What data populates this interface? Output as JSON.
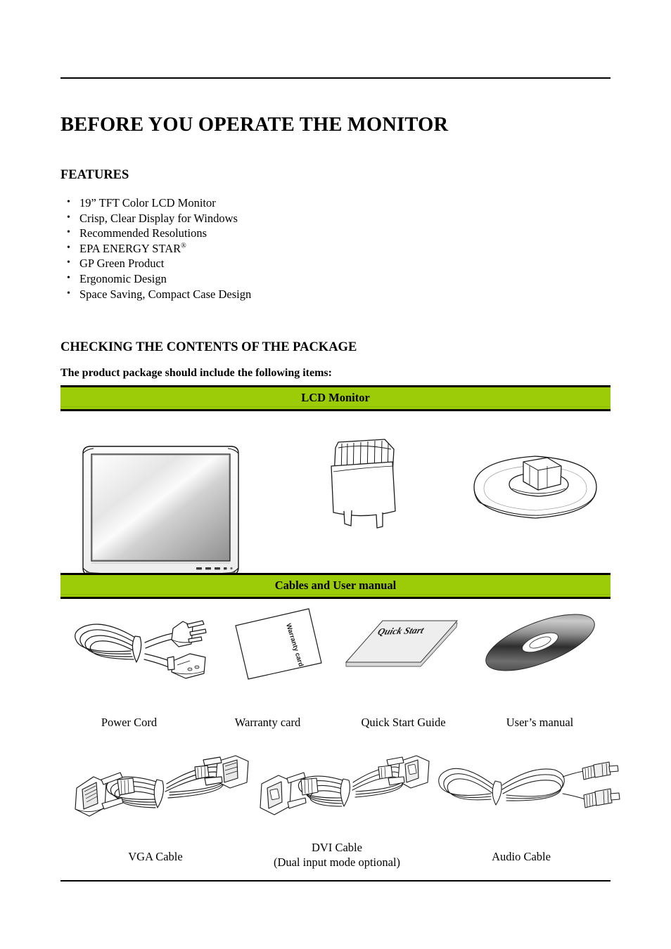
{
  "document": {
    "title": "BEFORE YOU OPERATE THE MONITOR",
    "sections": {
      "features_heading": "FEATURES",
      "checking_heading": "CHECKING THE CONTENTS OF THE PACKAGE",
      "package_lead": "The product package should include the following items:"
    },
    "features": [
      {
        "text": "19” TFT Color LCD Monitor",
        "sup": ""
      },
      {
        "text": "Crisp, Clear Display for Windows",
        "sup": ""
      },
      {
        "text": "Recommended Resolutions",
        "sup": ""
      },
      {
        "text": "EPA ENERGY STAR",
        "sup": "®"
      },
      {
        "text": "GP Green Product",
        "sup": ""
      },
      {
        "text": "Ergonomic Design",
        "sup": ""
      },
      {
        "text": "Space Saving, Compact Case Design",
        "sup": ""
      }
    ],
    "package": {
      "band_monitor": "LCD Monitor",
      "band_cables": "Cables and User manual",
      "accent_color": "#9ccc07",
      "monitor_items": [
        {
          "name": "lcd-panel",
          "label": ""
        },
        {
          "name": "stand-neck",
          "label": ""
        },
        {
          "name": "stand-base",
          "label": ""
        }
      ],
      "media_items": [
        {
          "name": "power-cord",
          "label": "Power Cord"
        },
        {
          "name": "warranty-card",
          "label": "Warranty card",
          "artwork_text": "Warranty card"
        },
        {
          "name": "quick-start-guide",
          "label": "Quick Start Guide",
          "artwork_text": "Quick Start"
        },
        {
          "name": "users-manual-disc",
          "label": "User’s manual"
        }
      ],
      "cable_items": [
        {
          "name": "vga-cable",
          "label": "VGA Cable",
          "sub_label": ""
        },
        {
          "name": "dvi-cable",
          "label": "DVI Cable",
          "sub_label": "(Dual input mode optional)"
        },
        {
          "name": "audio-cable",
          "label": "Audio Cable",
          "sub_label": ""
        }
      ]
    }
  }
}
